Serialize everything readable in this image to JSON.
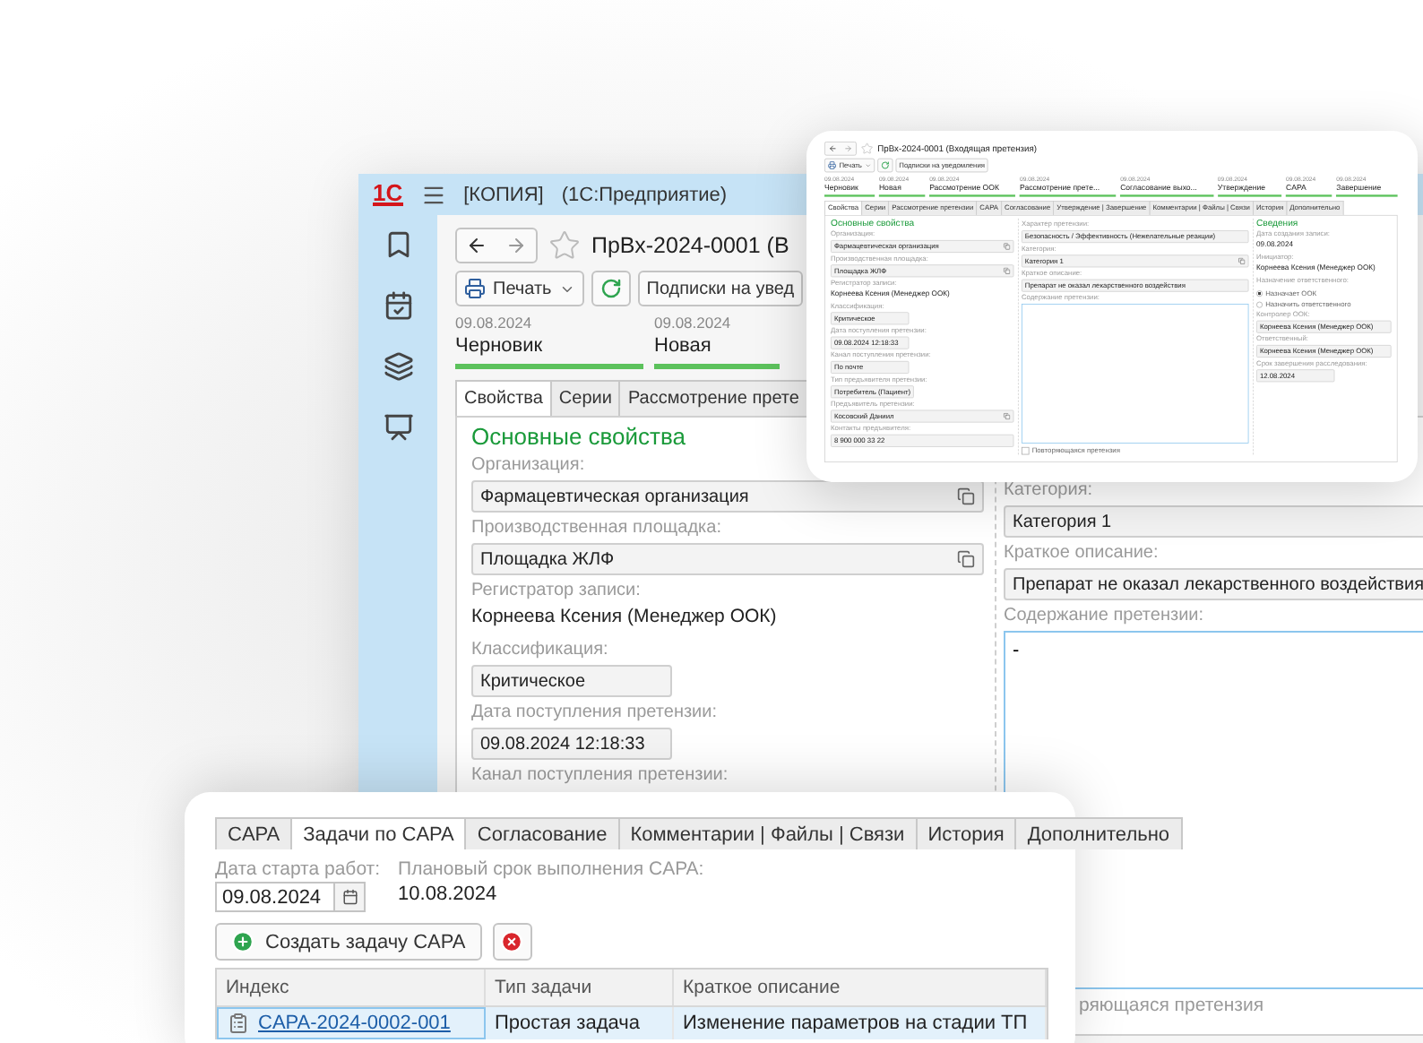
{
  "main_window": {
    "logo": "1С",
    "title": "[КОПИЯ]",
    "app_name": "(1С:Предприятие)",
    "form": {
      "title": "ПрВх-2024-0001 (В",
      "print": "Печать",
      "subscriptions": "Подписки на увед",
      "stages": [
        {
          "date": "09.08.2024",
          "name": "Черновик",
          "done": true
        },
        {
          "date": "09.08.2024",
          "name": "Новая",
          "done": true
        }
      ],
      "tabs": [
        {
          "label": "Свойства",
          "selected": true
        },
        {
          "label": "Серии",
          "selected": false
        },
        {
          "label": "Рассмотрение прете",
          "selected": false
        }
      ],
      "columns": [
        {
          "section": "Основные свойства",
          "fields": [
            {
              "kind": "select",
              "label": "Организация:",
              "value": "Фармацевтическая организация"
            },
            {
              "kind": "select",
              "label": "Производственная площадка:",
              "value": "Площадка ЖЛФ"
            },
            {
              "kind": "text",
              "label": "Регистратор записи:",
              "value": "Корнеева Ксения (Менеджер ООК)"
            },
            {
              "kind": "short",
              "label": "Классификация:",
              "value": "Критическое"
            },
            {
              "kind": "short",
              "label": "Дата поступления претензии:",
              "value": "09.08.2024 12:18:33"
            },
            {
              "kind": "text",
              "label": "Канал поступления претензии:"
            }
          ]
        },
        {
          "fields": [
            {
              "kind": "input",
              "label": "Категория:",
              "value": "Категория 1"
            },
            {
              "kind": "input",
              "label": "Краткое описание:",
              "value": "Препарат не оказал лекарственного воздействия"
            },
            {
              "kind": "textarea",
              "label": "Содержание претензии:",
              "value": "-"
            },
            {
              "kind": "caption",
              "label": "ряющаяся претензия"
            }
          ]
        }
      ]
    }
  },
  "claim_preview": {
    "form": {
      "title": "ПрВх-2024-0001 (Входящая претензия)",
      "print": "Печать",
      "subscriptions": "Подписки на уведомления",
      "stages": [
        {
          "date": "09.08.2024",
          "name": "Черновик",
          "done": true
        },
        {
          "date": "09.08.2024",
          "name": "Новая",
          "done": true
        },
        {
          "date": "09.08.2024",
          "name": "Рассмотрение ООК",
          "done": true
        },
        {
          "date": "09.08.2024",
          "name": "Рассмотрение прете...",
          "done": true
        },
        {
          "date": "09.08.2024",
          "name": "Согласование выхо...",
          "done": true
        },
        {
          "date": "09.08.2024",
          "name": "Утверждение",
          "done": true
        },
        {
          "date": "09.08.2024",
          "name": "CAPA",
          "done": true
        },
        {
          "date": "09.08.2024",
          "name": "Завершение",
          "done": true
        }
      ],
      "tabs": [
        {
          "label": "Свойства",
          "selected": true
        },
        {
          "label": "Серии",
          "selected": false
        },
        {
          "label": "Рассмотрение претензии",
          "selected": false
        },
        {
          "label": "CAPA",
          "selected": false
        },
        {
          "label": "Согласование",
          "selected": false
        },
        {
          "label": "Утверждение | Завершение",
          "selected": false
        },
        {
          "label": "Комментарии | Файлы | Связи",
          "selected": false
        },
        {
          "label": "История",
          "selected": false
        },
        {
          "label": "Дополнительно",
          "selected": false
        }
      ],
      "columns": [
        {
          "section": "Основные свойства",
          "fields": [
            {
              "kind": "select",
              "label": "Организация:",
              "value": "Фармацевтическая организация"
            },
            {
              "kind": "select",
              "label": "Производственная площадка:",
              "value": "Площадка ЖЛФ"
            },
            {
              "kind": "text",
              "label": "Регистратор записи:",
              "value": "Корнеева Ксения (Менеджер ООК)"
            },
            {
              "kind": "short",
              "label": "Классификация:",
              "value": "Критическое"
            },
            {
              "kind": "short",
              "label": "Дата поступления претензии:",
              "value": "09.08.2024 12:18:33"
            },
            {
              "kind": "short",
              "label": "Канал поступления претензии:",
              "value": "По почте"
            },
            {
              "kind": "short",
              "label": "Тип предъявителя претензии:",
              "value": "Потребитель (Пациент)"
            },
            {
              "kind": "select",
              "label": "Предъявитель претензии:",
              "value": "Косовский Даниил"
            },
            {
              "kind": "input",
              "label": "Контакты предъявителя:",
              "value": "8 900 000 33 22"
            }
          ]
        },
        {
          "fields": [
            {
              "kind": "input",
              "label": "Характер претензии:",
              "value": "Безопасность / Эффективность (Нежелательные реакции)"
            },
            {
              "kind": "select",
              "label": "Категория:",
              "value": "Категория 1"
            },
            {
              "kind": "input",
              "label": "Краткое описание:",
              "value": "Препарат не оказал лекарственного воздействия"
            },
            {
              "kind": "textarea",
              "label": "Содержание претензии:"
            },
            {
              "kind": "checkbox",
              "label": "Повторяющаяся претензия",
              "checked": false
            }
          ]
        },
        {
          "section": "Сведения",
          "fields": [
            {
              "kind": "text",
              "label": "Дата создания записи:",
              "value": "09.08.2024"
            },
            {
              "kind": "text",
              "label": "Инициатор:",
              "value": "Корнеева Ксения (Менеджер ООК)"
            },
            {
              "kind": "radio",
              "label": "Назначение ответственного:",
              "options": [
                {
                  "label": "Назначает ООК",
                  "selected": true
                },
                {
                  "label": "Назначить ответственного",
                  "selected": false
                }
              ]
            },
            {
              "kind": "input",
              "label": "Контролер ООК:",
              "value": "Корнеева Ксения (Менеджер ООК)"
            },
            {
              "kind": "input",
              "label": "Ответственный:",
              "value": "Корнеева Ксения (Менеджер ООК)"
            },
            {
              "kind": "short",
              "label": "Срок завершения расследования:",
              "value": "12.08.2024"
            }
          ]
        }
      ]
    }
  },
  "capa_panel": {
    "tabs": [
      {
        "label": "CAPA",
        "selected": false
      },
      {
        "label": "Задачи по CAPA",
        "selected": true
      },
      {
        "label": "Согласование",
        "selected": false
      },
      {
        "label": "Комментарии | Файлы | Связи",
        "selected": false
      },
      {
        "label": "История",
        "selected": false
      },
      {
        "label": "Дополнительно",
        "selected": false
      }
    ],
    "start_date": {
      "label": "Дата старта работ:",
      "value": "09.08.2024"
    },
    "planned": {
      "label": "Плановый срок выполнения CAPA:",
      "value": "10.08.2024"
    },
    "create_button": "Создать задачу CAPA",
    "table": {
      "columns": [
        "Индекс",
        "Тип задачи",
        "Краткое описание"
      ],
      "rows": [
        {
          "index": "CAPA-2024-0002-001",
          "type": "Простая задача",
          "description": "Изменение параметров на стадии ТП",
          "selected": true
        }
      ]
    }
  }
}
